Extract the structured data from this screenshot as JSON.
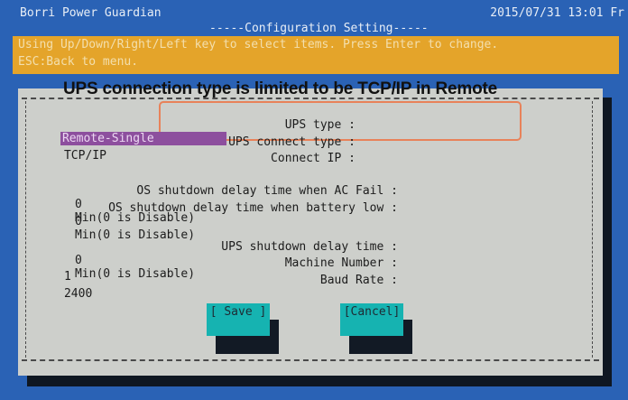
{
  "header": {
    "app_title": "Borri Power Guardian",
    "datetime": "2015/07/31 13:01 Fr",
    "section_title": "-----Configuration Setting-----"
  },
  "help": {
    "line1": "Using Up/Down/Right/Left key to select items. Press Enter to change.",
    "line2": "ESC:Back to menu."
  },
  "annotation": "UPS connection type is limited to be TCP/IP in Remote",
  "fields": {
    "ups_type": {
      "label": "UPS type :",
      "value": "Remote-Single"
    },
    "ups_connect_type": {
      "label": "UPS connect type :",
      "value": "TCP/IP"
    },
    "connect_ip": {
      "label": "Connect IP :",
      "value": ""
    },
    "os_shutdown_ac_fail": {
      "label": "OS shutdown delay time when AC Fail :",
      "value": "0",
      "unit": "Min(0 is Disable)"
    },
    "os_shutdown_batt_low": {
      "label": "OS shutdown delay time when battery low :",
      "value": "0",
      "unit": "Min(0 is Disable)"
    },
    "ups_shutdown_delay": {
      "label": "UPS shutdown delay time :",
      "value": "0",
      "unit": "Min(0 is Disable)"
    },
    "machine_number": {
      "label": "Machine Number :",
      "value": "1"
    },
    "baud_rate": {
      "label": "Baud Rate :",
      "value": "2400"
    }
  },
  "buttons": {
    "save": "[ Save ]",
    "cancel": "[Cancel]"
  },
  "colors": {
    "background": "#2a62b5",
    "help_bar": "#e4a42a",
    "dialog": "#cdcfcb",
    "selected_value": "#8d4f9e",
    "button": "#16b3b1",
    "highlight_border": "#e8825a"
  }
}
